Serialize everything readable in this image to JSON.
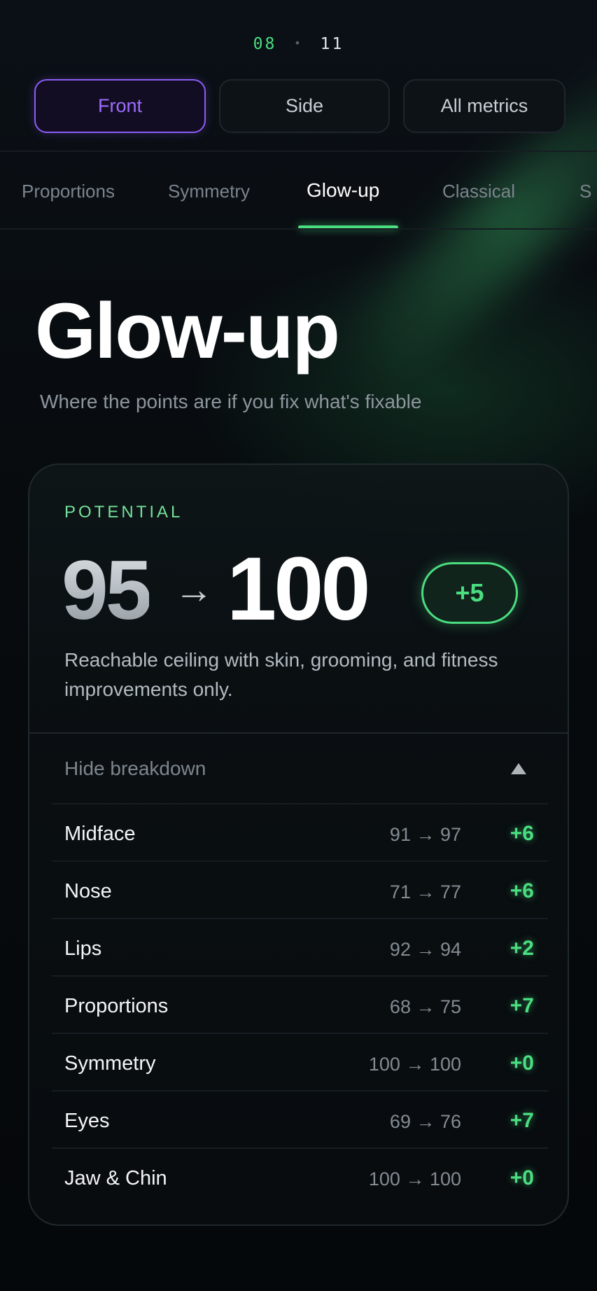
{
  "counter": {
    "current": "08",
    "separator": "•",
    "total": "11"
  },
  "view_tabs": [
    {
      "label": "Front",
      "active": true
    },
    {
      "label": "Side",
      "active": false
    },
    {
      "label": "All metrics",
      "active": false
    }
  ],
  "section_tabs": [
    {
      "label": "Proportions",
      "active": false
    },
    {
      "label": "Symmetry",
      "active": false
    },
    {
      "label": "Glow-up",
      "active": true
    },
    {
      "label": "Classical",
      "active": false
    },
    {
      "label": "S",
      "active": false
    }
  ],
  "header": {
    "title": "Glow-up",
    "subtitle": "Where the points are if you fix what's fixable"
  },
  "potential_card": {
    "label": "POTENTIAL",
    "score_from": "95",
    "arrow": "→",
    "score_to": "100",
    "delta": "+5",
    "description": "Reachable ceiling with skin, grooming, and fitness improvements only.",
    "toggle_label": "Hide breakdown",
    "breakdown": [
      {
        "name": "Midface",
        "range": "91 → 97",
        "delta": "+6"
      },
      {
        "name": "Nose",
        "range": "71 → 77",
        "delta": "+6"
      },
      {
        "name": "Lips",
        "range": "92 → 94",
        "delta": "+2"
      },
      {
        "name": "Proportions",
        "range": "68 → 75",
        "delta": "+7"
      },
      {
        "name": "Symmetry",
        "range": "100 → 100",
        "delta": "+0"
      },
      {
        "name": "Eyes",
        "range": "69 → 76",
        "delta": "+7"
      },
      {
        "name": "Jaw & Chin",
        "range": "100 → 100",
        "delta": "+0"
      }
    ]
  },
  "colors": {
    "accent_green": "#4ade80",
    "accent_purple": "#8b5cf6",
    "background": "#05080a"
  }
}
